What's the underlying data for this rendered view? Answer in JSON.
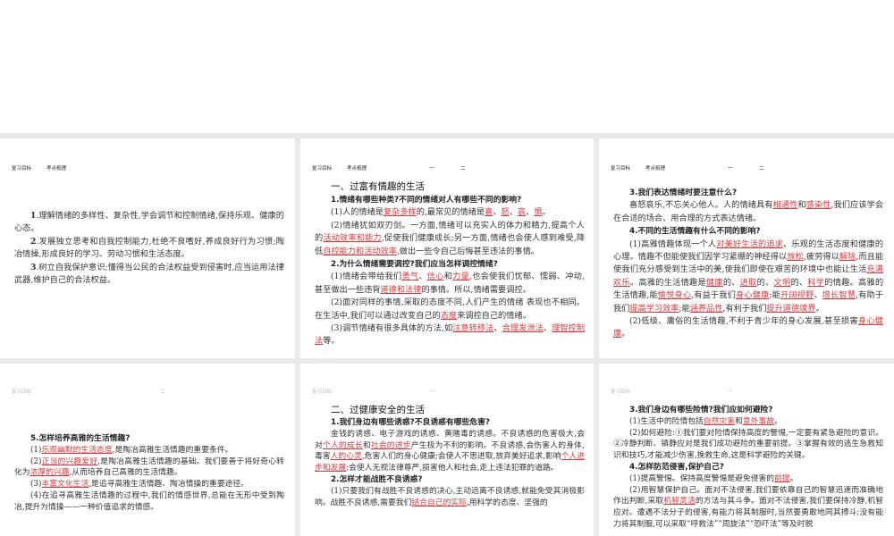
{
  "slides": [
    {
      "header": [
        "复习目标",
        "考点梳理"
      ],
      "tabs": [],
      "paras": [
        {
          "type": "p",
          "runs": [
            {
              "t": "1",
              "b": 1
            },
            {
              "t": ".理解情绪的多样性、复杂性,学会调节和控制情绪,保持乐观、健康的心态。"
            }
          ]
        },
        {
          "type": "p",
          "runs": [
            {
              "t": "2",
              "b": 1
            },
            {
              "t": ".发展独立思考和自我控制能力,杜绝不良嗜好,养成良好行为习惯;陶冶情操,形成良好的学习、劳动习惯和生活态度。"
            }
          ]
        },
        {
          "type": "p",
          "runs": [
            {
              "t": "3",
              "b": 1
            },
            {
              "t": ".树立自我保护意识;懂得当公民的合法权益受到侵害时,应当运用法律武器,维护自己的合法权益。"
            }
          ]
        }
      ]
    },
    {
      "header": [
        "复习目标",
        "考点梳理"
      ],
      "tabs": [
        "一",
        "二"
      ],
      "paras": [
        {
          "type": "h",
          "runs": [
            {
              "t": "一、过富有情趣的生活"
            }
          ]
        },
        {
          "type": "q",
          "runs": [
            {
              "t": "1.情绪有哪些种类?不同的情绪对人有哪些不同的影响?"
            }
          ]
        },
        {
          "type": "p",
          "runs": [
            {
              "t": "(1)人的情绪是"
            },
            {
              "t": "复杂多样",
              "hl": 1
            },
            {
              "t": "的,最常见的情绪是"
            },
            {
              "t": "喜",
              "hl": 1
            },
            {
              "t": "、"
            },
            {
              "t": "怒",
              "hl": 1
            },
            {
              "t": "、"
            },
            {
              "t": "哀",
              "hl": 1
            },
            {
              "t": "、"
            },
            {
              "t": "惧",
              "hl": 1
            },
            {
              "t": "。"
            }
          ]
        },
        {
          "type": "p",
          "runs": [
            {
              "t": "(2)情绪犹如双刃剑。一方面,情绪可以充实人的体力和精力,提高个人的"
            },
            {
              "t": "活动效率和能力",
              "hl": 1
            },
            {
              "t": ",促使我们健康成长;另一方面,情绪也会使人感到难受,降低"
            },
            {
              "t": "自控能力和活动效率",
              "hl": 1
            },
            {
              "t": ",做出一些令自己后悔甚至违法的事情。"
            }
          ]
        },
        {
          "type": "q",
          "runs": [
            {
              "t": "2.为什么情绪需要调控?我们应当怎样调控情绪?"
            }
          ]
        },
        {
          "type": "p",
          "runs": [
            {
              "t": "(1)情绪会带给我们"
            },
            {
              "t": "勇气",
              "hl": 1
            },
            {
              "t": "、"
            },
            {
              "t": "信心",
              "hl": 1
            },
            {
              "t": "和"
            },
            {
              "t": "力量",
              "hl": 1
            },
            {
              "t": ",也会使我们忧郁、懦弱、冲动,甚至做出一些违背"
            },
            {
              "t": "道德和法律",
              "hl": 1
            },
            {
              "t": "的事情。所以,情绪需要调控。"
            }
          ]
        },
        {
          "type": "p",
          "runs": [
            {
              "t": "(2)面对同样的事情,采取的态度不同,人们产生的情绪 表现也不相同。在生活中,我们可以通过改变自己的"
            },
            {
              "t": "态度",
              "hl": 1
            },
            {
              "t": "来调控自己的情绪。"
            }
          ]
        },
        {
          "type": "p",
          "runs": [
            {
              "t": "(3)调节情绪有很多具体的方法,如"
            },
            {
              "t": "注意转移法",
              "hl": 1
            },
            {
              "t": "、"
            },
            {
              "t": "合理发泄法",
              "hl": 1
            },
            {
              "t": "、"
            },
            {
              "t": "理智控制法",
              "hl": 1
            },
            {
              "t": "等。"
            }
          ]
        }
      ]
    },
    {
      "header": [
        "复习目标",
        "考点梳理"
      ],
      "tabs": [
        "一",
        "二"
      ],
      "paras": [
        {
          "type": "q",
          "runs": [
            {
              "t": "3.我们表达情绪时要注意什么?"
            }
          ]
        },
        {
          "type": "p",
          "runs": [
            {
              "t": "喜怒哀乐,不忘关心他人。人的情绪具有"
            },
            {
              "t": "相通性",
              "hl": 1
            },
            {
              "t": "和"
            },
            {
              "t": "感染性",
              "hl": 1
            },
            {
              "t": ",我们应该学会在合适的场合、用合理的方式表达情绪。"
            }
          ]
        },
        {
          "type": "q",
          "runs": [
            {
              "t": "4.不同的生活情趣有什么不同的影响?"
            }
          ]
        },
        {
          "type": "p",
          "runs": [
            {
              "t": "(1)高雅情趣体现一个人"
            },
            {
              "t": "对美好生活的追求",
              "hl": 1
            },
            {
              "t": "、乐观的生活态度和健康的心理。情趣不但能使我们因学习紧绷的神经得以"
            },
            {
              "t": "放松",
              "hl": 1
            },
            {
              "t": ",疲劳得以"
            },
            {
              "t": "解除",
              "hl": 1
            },
            {
              "t": ",而且能使我们充分感受到生活中的美,使我们即使在艰苦的环境中也能让生活"
            },
            {
              "t": "充满欢乐",
              "hl": 1
            },
            {
              "t": "。高雅的生活情趣是"
            },
            {
              "t": "健康",
              "hl": 1
            },
            {
              "t": "的、"
            },
            {
              "t": "进取",
              "hl": 1
            },
            {
              "t": "的、"
            },
            {
              "t": "文明",
              "hl": 1
            },
            {
              "t": "的、"
            },
            {
              "t": "科学",
              "hl": 1
            },
            {
              "t": "的情趣。高雅的生活情趣,能"
            },
            {
              "t": "愉悦身心",
              "hl": 1
            },
            {
              "t": ",有益于我们"
            },
            {
              "t": "身心健康",
              "hl": 1
            },
            {
              "t": ";能"
            },
            {
              "t": "开阔视野",
              "hl": 1
            },
            {
              "t": "、"
            },
            {
              "t": "增长智慧",
              "hl": 1
            },
            {
              "t": ",有助于我们"
            },
            {
              "t": "提高学习效率",
              "hl": 1
            },
            {
              "t": ";能"
            },
            {
              "t": "涵养品性",
              "hl": 1
            },
            {
              "t": ",有利于我们"
            },
            {
              "t": "提升道德境界",
              "hl": 1
            },
            {
              "t": "。"
            }
          ]
        },
        {
          "type": "p",
          "runs": [
            {
              "t": "(2)低级、庸俗的生活情趣,不利于青少年的身心发展,甚至损害"
            },
            {
              "t": "身心健康",
              "hl": 1
            },
            {
              "t": "。"
            }
          ]
        }
      ]
    },
    {
      "header": [
        "复习目标"
      ],
      "tabs": [
        "",
        "二"
      ],
      "paras": [
        {
          "type": "q",
          "runs": [
            {
              "t": "5.怎样培养高雅的生活情趣?"
            }
          ]
        },
        {
          "type": "p",
          "runs": [
            {
              "t": "(1)"
            },
            {
              "t": "乐观幽默的生活态度",
              "hl": 1
            },
            {
              "t": ",是陶冶高雅生活情趣的重要条件。"
            }
          ]
        },
        {
          "type": "p",
          "runs": [
            {
              "t": "(2)"
            },
            {
              "t": "正当的兴趣爱好",
              "hl": 1
            },
            {
              "t": ",是陶冶高雅生活情趣的基础。我们要善于将好奇心转化为"
            },
            {
              "t": "浓厚的兴趣",
              "hl": 1
            },
            {
              "t": ",从而培养自己高雅的生活情趣。"
            }
          ]
        },
        {
          "type": "p",
          "runs": [
            {
              "t": "(3)"
            },
            {
              "t": "丰富文化生活",
              "hl": 1
            },
            {
              "t": ",是追寻高雅生活情趣、陶冶情操的重要途径。"
            }
          ]
        },
        {
          "type": "p",
          "runs": [
            {
              "t": "(4)在追寻高雅生活情趣的过程中,我们的情感世界,总能在无形中受到陶冶,提升为情操——一种价值追求的情感。"
            }
          ]
        }
      ]
    },
    {
      "header": [
        "复习目标"
      ],
      "tabs": [
        "一"
      ],
      "paras": [
        {
          "type": "h",
          "runs": [
            {
              "t": "二、过健康安全的生活"
            }
          ]
        },
        {
          "type": "q",
          "runs": [
            {
              "t": "1.我们身边有哪些诱惑?不良诱惑有哪些危害?"
            }
          ]
        },
        {
          "type": "p",
          "runs": [
            {
              "t": "金钱的诱惑、电子游戏的诱惑、黄赌毒的诱惑。不良诱惑的危害极大,会对"
            },
            {
              "t": "个人的成长",
              "hl": 1
            },
            {
              "t": "和"
            },
            {
              "t": "社会的进步",
              "hl": 1
            },
            {
              "t": "产生极为不利的影响。不良诱惑,会伤害人的身体,毒害"
            },
            {
              "t": "人的心灵",
              "hl": 1
            },
            {
              "t": ",危害人们的身心健康;会使人不思进取,放弃美好追求,影响"
            },
            {
              "t": "个人进步和发展",
              "hl": 1
            },
            {
              "t": ";会使人无视法律尊严,损害他人和社会,走上违法犯罪的道路。"
            }
          ]
        },
        {
          "type": "q",
          "runs": [
            {
              "t": "2.怎样才能战胜不良诱惑?"
            }
          ]
        },
        {
          "type": "p",
          "runs": [
            {
              "t": "(1)只要我们有战胜不良诱惑的决心,主动远离不良诱惑,就能免受其消极影响。战胜不良诱惑,需要我们"
            },
            {
              "t": "结合自己的实际",
              "hl": 1
            },
            {
              "t": ",用科学的态度、坚强的"
            }
          ]
        }
      ]
    },
    {
      "header": [
        "复习目标"
      ],
      "tabs": [
        "一"
      ],
      "paras": [
        {
          "type": "q",
          "runs": [
            {
              "t": "3.我们身边有哪些险情?我们应如何避险?"
            }
          ]
        },
        {
          "type": "p",
          "runs": [
            {
              "t": "(1)生活中的险情包括"
            },
            {
              "t": "自然灾害",
              "hl": 1
            },
            {
              "t": "和"
            },
            {
              "t": "意外事故",
              "hl": 1
            },
            {
              "t": "。"
            }
          ]
        },
        {
          "type": "p",
          "runs": [
            {
              "t": "(2)如何避险:①我们要对险情保持高度的警惕,一定要有紧急避险的意识。②冷静判断、镇静应对是我们成功避险的重要前提。③掌握有效的逃生急救知识和技巧,才能减少伤害,挽救生命,这是科学避险的关键。"
            }
          ]
        },
        {
          "type": "q",
          "runs": [
            {
              "t": "4.怎样防范侵害,保护自己?"
            }
          ]
        },
        {
          "type": "p",
          "runs": [
            {
              "t": "(1)提高警惕。保持高度警惕是避免侵害的"
            },
            {
              "t": "前提",
              "hl": 1
            },
            {
              "t": "。"
            }
          ]
        },
        {
          "type": "p",
          "runs": [
            {
              "t": "(2)用智慧保护自己。面对不法侵害,我们要依靠自己的智慧迅速而准确地作出判断,采取"
            },
            {
              "t": "机智灵活",
              "hl": 1
            },
            {
              "t": "的方法与其斗争。面对不法侵害,我们要保持冷静,机智应对。遭遇不法分子的侵害,有能力将其制服时,当然要勇敢地同其搏斗;没有能力将其制服,可以采取“呼救法”“周旋法”“恐吓法”等及时脱"
            }
          ]
        }
      ]
    }
  ]
}
